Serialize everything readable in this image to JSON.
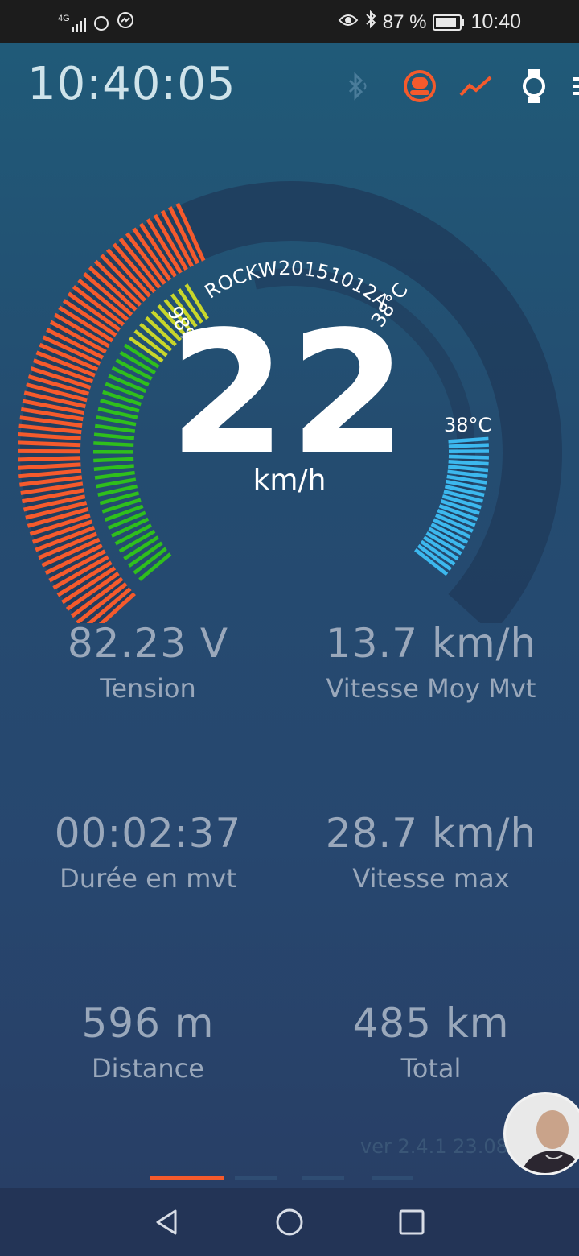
{
  "status_bar": {
    "network": "4G",
    "battery": "87 %",
    "time": "10:40",
    "icons": [
      "signal-icon",
      "app-notification-icon",
      "messenger-icon",
      "eye-comfort-icon",
      "bluetooth-icon",
      "battery-icon"
    ]
  },
  "header": {
    "clock": "10:40:05",
    "icons": [
      "bluetooth-icon",
      "wheel-icon",
      "chart-icon",
      "watch-icon",
      "menu-icon"
    ]
  },
  "gauge": {
    "speed": "22",
    "unit": "km/h",
    "device_name": "ROCKW20151012A",
    "battery_label": "98%",
    "battery_level": 0.98,
    "temperature_label_inner": "38°C",
    "temperature_label_outer": "38°C",
    "power_level": 0.55,
    "temperature_level": 0.38
  },
  "stats": [
    {
      "value": "82.23 V",
      "label": "Tension"
    },
    {
      "value": "13.7 km/h",
      "label": "Vitesse Moy Mvt"
    },
    {
      "value": "00:02:37",
      "label": "Durée en mvt"
    },
    {
      "value": "28.7 km/h",
      "label": "Vitesse max"
    },
    {
      "value": "596 m",
      "label": "Distance"
    },
    {
      "value": "485 km",
      "label": "Total"
    }
  ],
  "version": "ver 2.4.1 23.08",
  "pager": {
    "pages": 4,
    "active": 0
  },
  "colors": {
    "accent": "#f55a2c",
    "battery_green": "#2fbf1c",
    "battery_yellow": "#c8d62a",
    "temp_blue": "#3cb8ee",
    "track": "#1f3a5a"
  },
  "nav": [
    "back-icon",
    "home-icon",
    "recents-icon"
  ]
}
